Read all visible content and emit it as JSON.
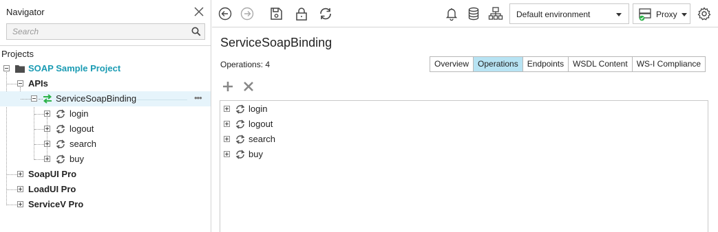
{
  "navigator": {
    "title": "Navigator",
    "search_placeholder": "Search",
    "section_label": "Projects",
    "tree": [
      {
        "label": "SOAP Sample Project",
        "style": "bold-teal",
        "icon": "folder-icon"
      },
      {
        "label": "APIs",
        "style": "bold"
      },
      {
        "label": "ServiceSoapBinding",
        "style": "normal",
        "icon": "binding-icon",
        "selected": true,
        "more": "•••"
      },
      {
        "label": "login",
        "style": "normal",
        "icon": "operation-icon"
      },
      {
        "label": "logout",
        "style": "normal",
        "icon": "operation-icon"
      },
      {
        "label": "search",
        "style": "normal",
        "icon": "operation-icon"
      },
      {
        "label": "buy",
        "style": "normal",
        "icon": "operation-icon"
      },
      {
        "label": "SoapUI Pro",
        "style": "bold"
      },
      {
        "label": "LoadUI Pro",
        "style": "bold"
      },
      {
        "label": "ServiceV Pro",
        "style": "bold"
      }
    ]
  },
  "toolbar": {
    "icons": [
      "back-icon",
      "forward-icon",
      "save-icon",
      "lock-icon",
      "refresh-icon",
      "notifications-icon",
      "database-icon",
      "network-icon",
      "settings-icon"
    ],
    "environment": "Default environment",
    "proxy_label": "Proxy"
  },
  "main": {
    "title": "ServiceSoapBinding",
    "operations_count": "Operations: 4",
    "tabs": [
      {
        "label": "Overview",
        "active": false
      },
      {
        "label": "Operations",
        "active": true
      },
      {
        "label": "Endpoints",
        "active": false
      },
      {
        "label": "WSDL Content",
        "active": false
      },
      {
        "label": "WS-I Compliance",
        "active": false
      }
    ],
    "operations": [
      "login",
      "logout",
      "search",
      "buy"
    ]
  },
  "colors": {
    "accent_teal": "#1a9bb3",
    "active_tab": "#b7e3f3",
    "selected_row": "#e6f4fb",
    "binding_green": "#2db34a"
  }
}
